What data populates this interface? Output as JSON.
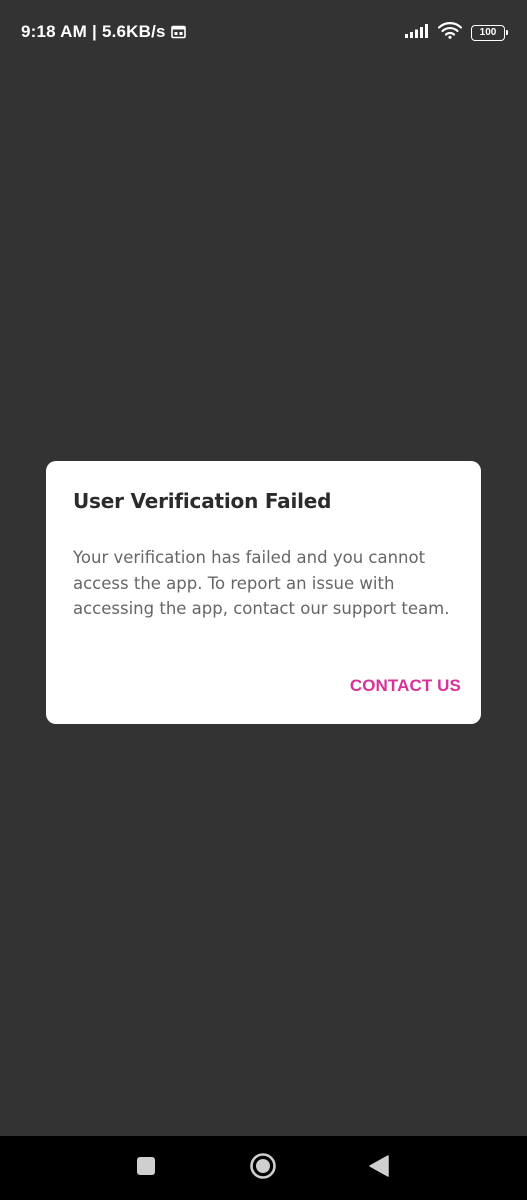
{
  "status_bar": {
    "time": "9:18 AM",
    "separator": "|",
    "network_speed": "5.6KB/s",
    "battery_level": "100",
    "icons": [
      "calendar-icon",
      "signal-icon",
      "wifi-icon",
      "battery-icon"
    ]
  },
  "dialog": {
    "title": "User Verification Failed",
    "message": "Your verification has failed and you cannot access the app. To report an issue with accessing the app, contact our support team.",
    "action_label": "CONTACT US"
  },
  "nav_bar": {
    "icons": [
      "recents-icon",
      "home-icon",
      "back-icon"
    ]
  },
  "colors": {
    "background": "#333333",
    "dialog_background": "#ffffff",
    "title": "#2b2b2b",
    "message": "#666666",
    "accent": "#d6339a",
    "nav_bar": "#000000"
  }
}
